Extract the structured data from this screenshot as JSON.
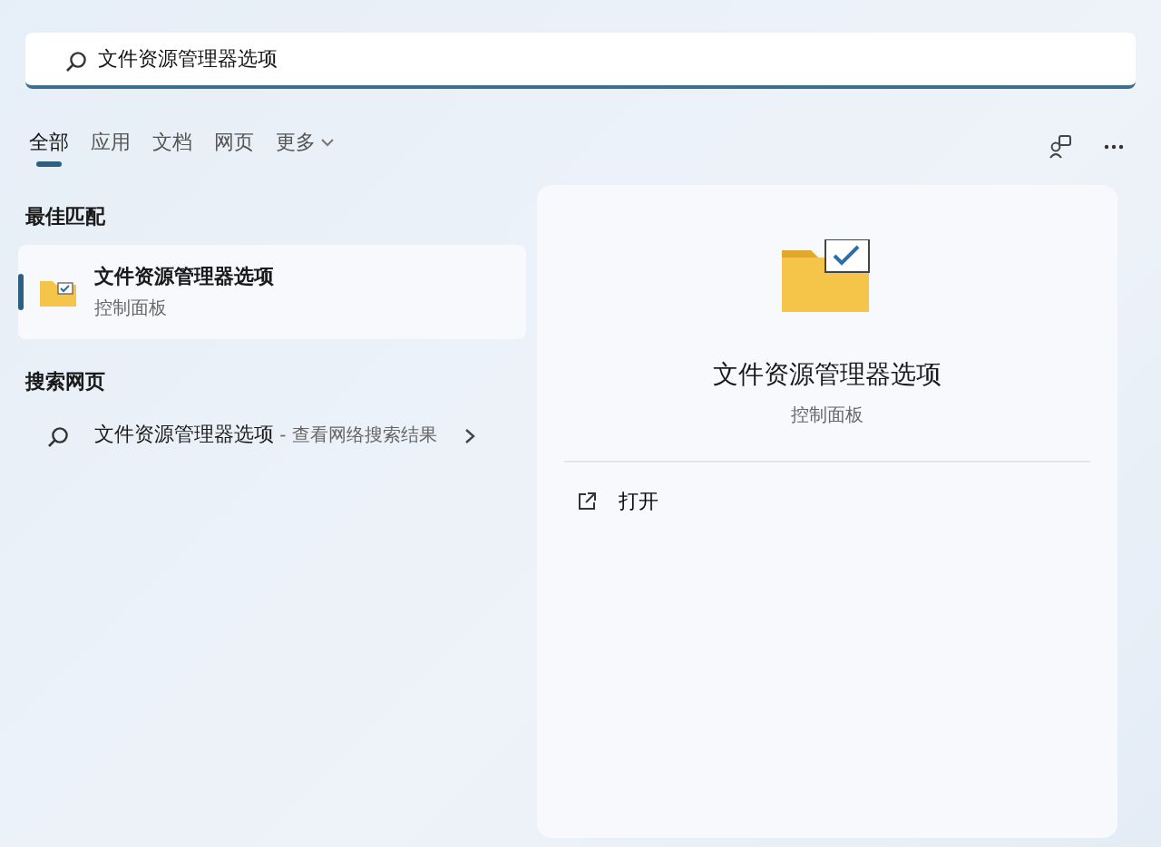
{
  "search": {
    "value": "文件资源管理器选项"
  },
  "tabs": [
    {
      "label": "全部",
      "selected": true,
      "kind": "plain"
    },
    {
      "label": "应用",
      "selected": false,
      "kind": "plain"
    },
    {
      "label": "文档",
      "selected": false,
      "kind": "plain"
    },
    {
      "label": "网页",
      "selected": false,
      "kind": "plain"
    },
    {
      "label": "更多",
      "selected": false,
      "kind": "dropdown"
    }
  ],
  "best_match": {
    "heading": "最佳匹配",
    "title": "文件资源管理器选项",
    "subtitle": "控制面板",
    "selected": true
  },
  "web_search": {
    "heading": "搜索网页",
    "title": "文件资源管理器选项",
    "suffix": " - 查看网络搜索结果"
  },
  "details": {
    "title": "文件资源管理器选项",
    "subtitle": "控制面板",
    "actions": [
      {
        "label": "打开"
      }
    ]
  }
}
